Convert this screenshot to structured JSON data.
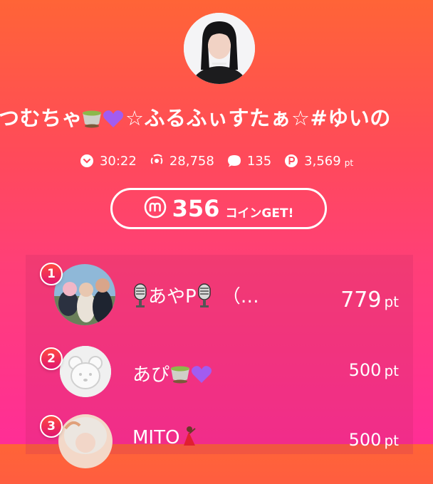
{
  "profile": {
    "title_prefix": "つむちゃ",
    "title_star1": "☆ふるふぃすたぁ☆#ゆいの"
  },
  "stats": {
    "duration": "30:22",
    "viewers": "28,758",
    "comments": "135",
    "points": "3,569",
    "points_unit": "pt"
  },
  "coin_button": {
    "amount": "356",
    "suffix": "コインGET!"
  },
  "ranking": [
    {
      "rank": "1",
      "name_before": "",
      "name_mid": "あやP",
      "name_after": "（…",
      "points": "779",
      "unit": "pt"
    },
    {
      "rank": "2",
      "name_mid": "あぴ",
      "points": "500",
      "unit": "pt"
    },
    {
      "rank": "3",
      "name_mid": "MITO",
      "points": "500",
      "unit": "pt"
    }
  ],
  "colors": {
    "bg_top": "#ff6437",
    "bg_bottom": "#ff2e96",
    "rank_badge": "#ff3a55"
  },
  "icons": [
    "chevron-circle-icon",
    "broadcast-icon",
    "comment-icon",
    "points-icon",
    "coin-m-icon",
    "tea-emoji-icon",
    "purple-heart-icon",
    "microphone-icon",
    "dancer-emoji-icon"
  ]
}
